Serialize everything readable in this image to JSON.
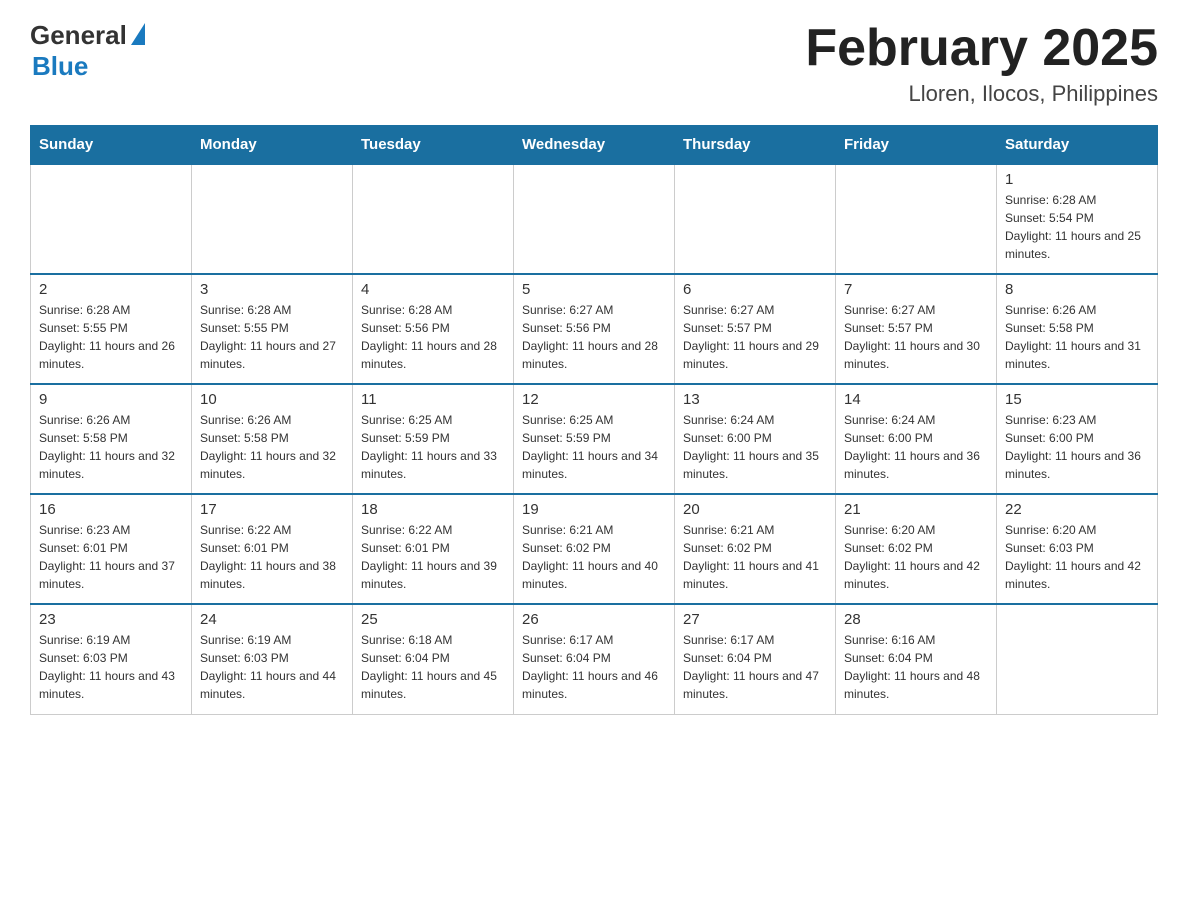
{
  "header": {
    "logo_general": "General",
    "logo_blue": "Blue",
    "title": "February 2025",
    "subtitle": "Lloren, Ilocos, Philippines"
  },
  "weekdays": [
    "Sunday",
    "Monday",
    "Tuesday",
    "Wednesday",
    "Thursday",
    "Friday",
    "Saturday"
  ],
  "weeks": [
    [
      {
        "day": "",
        "info": ""
      },
      {
        "day": "",
        "info": ""
      },
      {
        "day": "",
        "info": ""
      },
      {
        "day": "",
        "info": ""
      },
      {
        "day": "",
        "info": ""
      },
      {
        "day": "",
        "info": ""
      },
      {
        "day": "1",
        "info": "Sunrise: 6:28 AM\nSunset: 5:54 PM\nDaylight: 11 hours and 25 minutes."
      }
    ],
    [
      {
        "day": "2",
        "info": "Sunrise: 6:28 AM\nSunset: 5:55 PM\nDaylight: 11 hours and 26 minutes."
      },
      {
        "day": "3",
        "info": "Sunrise: 6:28 AM\nSunset: 5:55 PM\nDaylight: 11 hours and 27 minutes."
      },
      {
        "day": "4",
        "info": "Sunrise: 6:28 AM\nSunset: 5:56 PM\nDaylight: 11 hours and 28 minutes."
      },
      {
        "day": "5",
        "info": "Sunrise: 6:27 AM\nSunset: 5:56 PM\nDaylight: 11 hours and 28 minutes."
      },
      {
        "day": "6",
        "info": "Sunrise: 6:27 AM\nSunset: 5:57 PM\nDaylight: 11 hours and 29 minutes."
      },
      {
        "day": "7",
        "info": "Sunrise: 6:27 AM\nSunset: 5:57 PM\nDaylight: 11 hours and 30 minutes."
      },
      {
        "day": "8",
        "info": "Sunrise: 6:26 AM\nSunset: 5:58 PM\nDaylight: 11 hours and 31 minutes."
      }
    ],
    [
      {
        "day": "9",
        "info": "Sunrise: 6:26 AM\nSunset: 5:58 PM\nDaylight: 11 hours and 32 minutes."
      },
      {
        "day": "10",
        "info": "Sunrise: 6:26 AM\nSunset: 5:58 PM\nDaylight: 11 hours and 32 minutes."
      },
      {
        "day": "11",
        "info": "Sunrise: 6:25 AM\nSunset: 5:59 PM\nDaylight: 11 hours and 33 minutes."
      },
      {
        "day": "12",
        "info": "Sunrise: 6:25 AM\nSunset: 5:59 PM\nDaylight: 11 hours and 34 minutes."
      },
      {
        "day": "13",
        "info": "Sunrise: 6:24 AM\nSunset: 6:00 PM\nDaylight: 11 hours and 35 minutes."
      },
      {
        "day": "14",
        "info": "Sunrise: 6:24 AM\nSunset: 6:00 PM\nDaylight: 11 hours and 36 minutes."
      },
      {
        "day": "15",
        "info": "Sunrise: 6:23 AM\nSunset: 6:00 PM\nDaylight: 11 hours and 36 minutes."
      }
    ],
    [
      {
        "day": "16",
        "info": "Sunrise: 6:23 AM\nSunset: 6:01 PM\nDaylight: 11 hours and 37 minutes."
      },
      {
        "day": "17",
        "info": "Sunrise: 6:22 AM\nSunset: 6:01 PM\nDaylight: 11 hours and 38 minutes."
      },
      {
        "day": "18",
        "info": "Sunrise: 6:22 AM\nSunset: 6:01 PM\nDaylight: 11 hours and 39 minutes."
      },
      {
        "day": "19",
        "info": "Sunrise: 6:21 AM\nSunset: 6:02 PM\nDaylight: 11 hours and 40 minutes."
      },
      {
        "day": "20",
        "info": "Sunrise: 6:21 AM\nSunset: 6:02 PM\nDaylight: 11 hours and 41 minutes."
      },
      {
        "day": "21",
        "info": "Sunrise: 6:20 AM\nSunset: 6:02 PM\nDaylight: 11 hours and 42 minutes."
      },
      {
        "day": "22",
        "info": "Sunrise: 6:20 AM\nSunset: 6:03 PM\nDaylight: 11 hours and 42 minutes."
      }
    ],
    [
      {
        "day": "23",
        "info": "Sunrise: 6:19 AM\nSunset: 6:03 PM\nDaylight: 11 hours and 43 minutes."
      },
      {
        "day": "24",
        "info": "Sunrise: 6:19 AM\nSunset: 6:03 PM\nDaylight: 11 hours and 44 minutes."
      },
      {
        "day": "25",
        "info": "Sunrise: 6:18 AM\nSunset: 6:04 PM\nDaylight: 11 hours and 45 minutes."
      },
      {
        "day": "26",
        "info": "Sunrise: 6:17 AM\nSunset: 6:04 PM\nDaylight: 11 hours and 46 minutes."
      },
      {
        "day": "27",
        "info": "Sunrise: 6:17 AM\nSunset: 6:04 PM\nDaylight: 11 hours and 47 minutes."
      },
      {
        "day": "28",
        "info": "Sunrise: 6:16 AM\nSunset: 6:04 PM\nDaylight: 11 hours and 48 minutes."
      },
      {
        "day": "",
        "info": ""
      }
    ]
  ]
}
